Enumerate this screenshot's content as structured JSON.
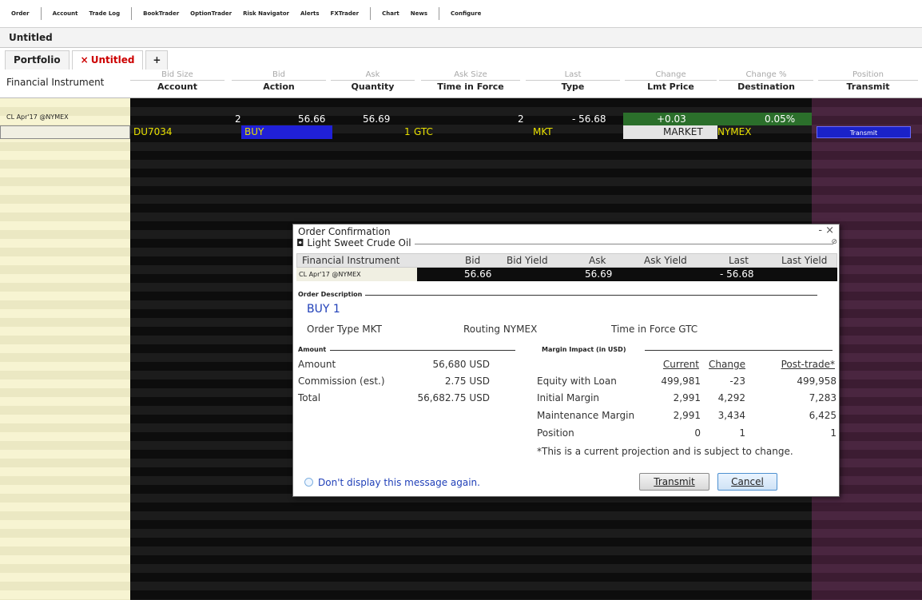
{
  "toolbar": {
    "items": [
      "Order",
      "Account",
      "Trade Log",
      "BookTrader",
      "OptionTrader",
      "Risk Navigator",
      "Alerts",
      "FXTrader",
      "Chart",
      "News",
      "Configure"
    ]
  },
  "window": {
    "title": "Untitled"
  },
  "tabs": {
    "portfolio": "Portfolio",
    "close_glyph": "×",
    "untitled": "Untitled",
    "add": "+"
  },
  "header": {
    "financial_instrument": "Financial Instrument",
    "columns": [
      {
        "top": "Bid Size",
        "bottom": "Account"
      },
      {
        "top": "Bid",
        "bottom": "Action"
      },
      {
        "top": "Ask",
        "bottom": "Quantity"
      },
      {
        "top": "Ask Size",
        "bottom": "Time in Force"
      },
      {
        "top": "Last",
        "bottom": "Type"
      },
      {
        "top": "Change",
        "bottom": "Lmt Price"
      },
      {
        "top": "Change %",
        "bottom": "Destination"
      },
      {
        "top": "Position",
        "bottom": "Transmit"
      }
    ]
  },
  "quote_row": {
    "symbol": "CL Apr'17 @NYMEX",
    "bid_size": "2",
    "bid": "56.66",
    "ask": "56.69",
    "ask_size": "2",
    "last": "- 56.68",
    "change": "+0.03",
    "change_pct": "0.05%"
  },
  "order_row": {
    "account": "DU7034",
    "action": "BUY",
    "quantity": "1",
    "tif": "GTC",
    "type": "MKT",
    "lmt_price": "MARKET",
    "destination": "NYMEX",
    "transmit": "Transmit"
  },
  "dialog": {
    "title": "Order Confirmation",
    "controls": {
      "minimize": "-",
      "close": "×"
    },
    "instrument_group": "Light Sweet Crude Oil",
    "quote_headers": [
      "Financial Instrument",
      "Bid",
      "Bid Yield",
      "Ask",
      "Ask Yield",
      "Last",
      "Last Yield"
    ],
    "quote": {
      "symbol": "CL Apr'17 @NYMEX",
      "bid": "56.66",
      "ask": "56.69",
      "last": "- 56.68"
    },
    "order_description_label": "Order Description",
    "order_summary": "BUY 1",
    "order_type": "Order Type MKT",
    "routing": "Routing NYMEX",
    "time_in_force": "Time in Force GTC",
    "amount_section": {
      "title": "Amount",
      "rows": [
        {
          "label": "Amount",
          "value": "56,680 USD"
        },
        {
          "label": "Commission (est.)",
          "value": "2.75 USD"
        },
        {
          "label": "Total",
          "value": "56,682.75 USD"
        }
      ]
    },
    "margin_section": {
      "title": "Margin Impact (in USD)",
      "headers": [
        "Current",
        "Change",
        "Post-trade*"
      ],
      "rows": [
        {
          "label": "Equity with Loan",
          "current": "499,981",
          "change": "-23",
          "post": "499,958"
        },
        {
          "label": "Initial Margin",
          "current": "2,991",
          "change": "4,292",
          "post": "7,283"
        },
        {
          "label": "Maintenance Margin",
          "current": "2,991",
          "change": "3,434",
          "post": "6,425"
        },
        {
          "label": "Position",
          "current": "0",
          "change": "1",
          "post": "1"
        }
      ],
      "footnote": "*This is a current projection and is subject to change."
    },
    "dont_show": "Don't display this message again.",
    "transmit_button": "Transmit",
    "cancel_button": "Cancel"
  },
  "colors": {
    "instrument_column": "#f7f4d2",
    "grid_background": "#0d0d0d",
    "position_column": "#3c1c32",
    "buy_highlight": "#2020d8",
    "change_positive": "#2b6f2b",
    "account_text": "#e8e000",
    "link_blue": "#1f3fb8"
  }
}
